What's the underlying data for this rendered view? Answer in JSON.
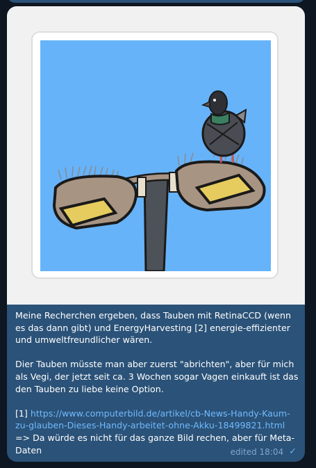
{
  "message": {
    "paragraph1": "Meine Recherchen ergeben, dass Tauben mit RetinaCCD (wenn es das dann gibt) und EnergyHarvesting [2] energie-effizienter und umweltfreundlicher wären.",
    "paragraph2": "Dier Tauben müsste man aber zuerst \"abrichten\", aber für mich als Vegi, der jetzt seit ca. 3 Wochen sogar Vagen einkauft ist das den Tauben zu liebe keine Option.",
    "ref_label": "[1]",
    "link_text": "https://www.computerbild.de/artikel/cb-News-Handy-Kaum-zu-glauben-Dieses-Handy-arbeitet-ohne-Akku-18499821.html",
    "last_line": "=> Da würde es nicht für das ganze Bild rechen, aber für Meta-Daten",
    "edited_label": "edited 18:04",
    "status_icon": "single-check-icon"
  },
  "sticker": {
    "subject": "pigeon-on-street-lamp",
    "background_color": "#66b3fa"
  },
  "colors": {
    "bubble": "#2b5278",
    "link": "#71baff",
    "meta": "#7da8d3",
    "app_background": "#0e1621"
  }
}
